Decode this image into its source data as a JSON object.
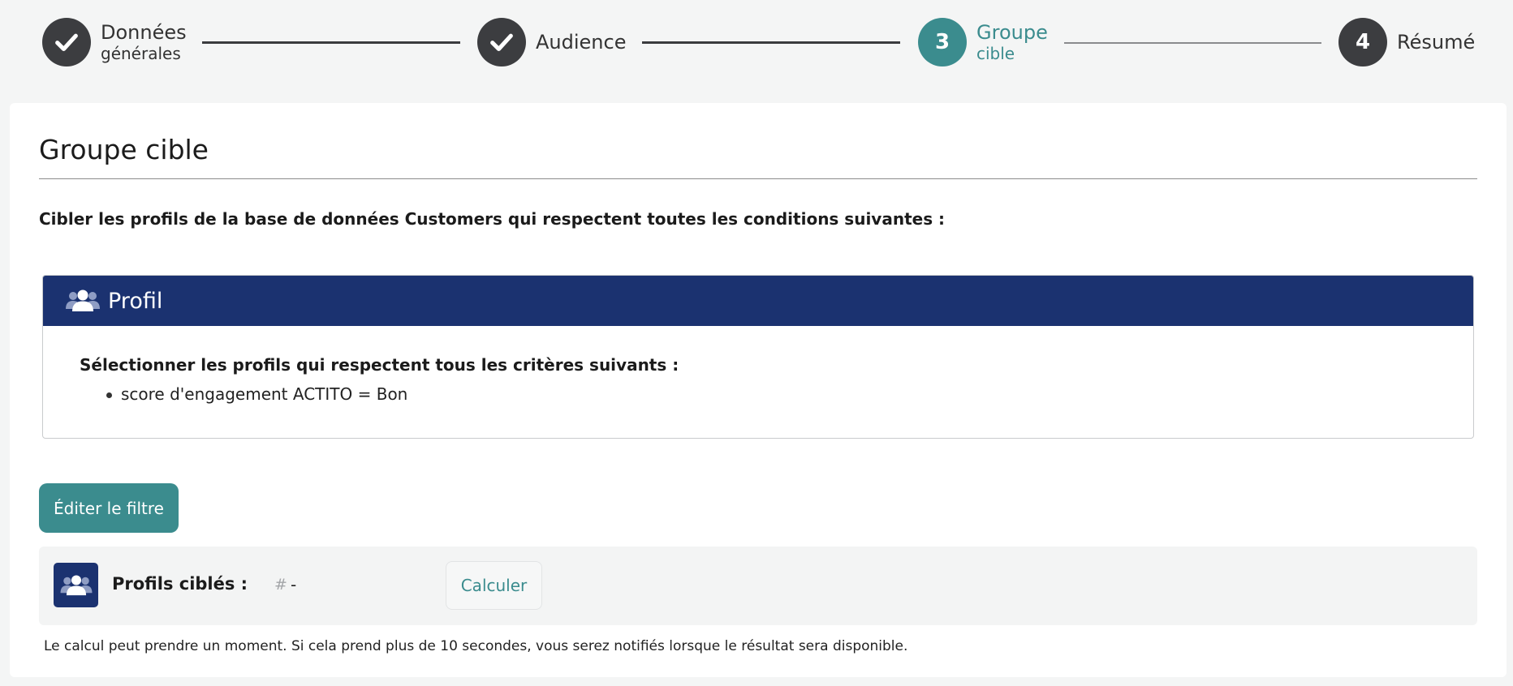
{
  "stepper": {
    "steps": [
      {
        "main": "Données",
        "sub": "générales",
        "state": "done",
        "icon": "check-icon"
      },
      {
        "main": "Audience",
        "sub": "",
        "state": "done",
        "icon": "check-icon"
      },
      {
        "main": "Groupe",
        "sub": "cible",
        "state": "active",
        "number": "3"
      },
      {
        "main": "Résumé",
        "sub": "",
        "state": "todo",
        "number": "4"
      }
    ]
  },
  "page": {
    "title": "Groupe cible",
    "intro": "Cibler les profils de la base de données Customers qui respectent toutes les conditions suivantes :"
  },
  "profil_panel": {
    "title": "Profil",
    "icon": "users-icon",
    "criteria_title": "Sélectionner les profils qui respectent tous les critères suivants :",
    "criteria": [
      "score d'engagement ACTITO = Bon"
    ]
  },
  "actions": {
    "edit_filter_label": "Éditer le filtre"
  },
  "target": {
    "label": "Profils ciblés :",
    "hash": "#",
    "value": "-",
    "calculate_label": "Calculer",
    "note": "Le calcul peut prendre un moment. Si cela prend plus de 10 secondes, vous serez notifiés lorsque le résultat sera disponible."
  },
  "colors": {
    "accent": "#3b8c8e",
    "navy": "#1b3270",
    "step_done": "#3c3d40"
  }
}
